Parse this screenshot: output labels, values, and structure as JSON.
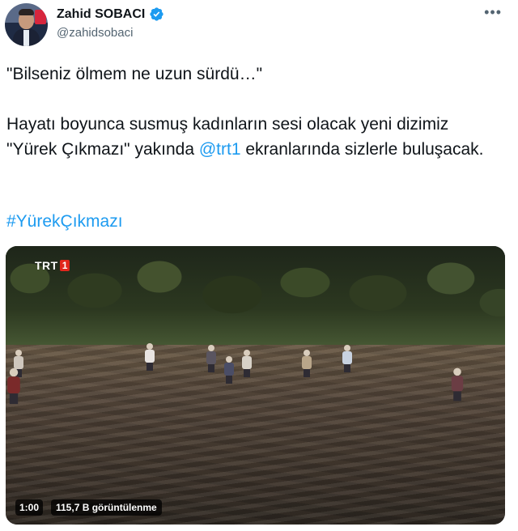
{
  "author": {
    "display_name": "Zahid SOBACI",
    "handle": "@zahidsobaci",
    "verified": true,
    "verified_color": "#1d9bf0"
  },
  "tweet": {
    "quote": "\"Bilseniz ölmem ne uzun sürdü…\"",
    "body_part1": "Hayatı boyunca susmuş kadınların sesi olacak yeni dizimiz \"Yürek Çıkmazı\" yakında ",
    "mention": "@trt1",
    "body_part2": " ekranlarında sizlerle buluşacak.",
    "hashtag": "#YürekÇıkmazı",
    "link_color": "#1d9bf0"
  },
  "media": {
    "channel_logo": "TRT",
    "channel_logo_number": "1",
    "duration": "1:00",
    "views": "115,7 B görüntülenme"
  },
  "icons": {
    "more": "more-horizontal-icon",
    "verified": "verified-badge-icon"
  }
}
